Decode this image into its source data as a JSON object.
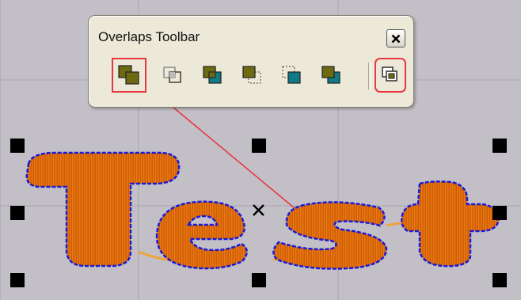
{
  "toolbar": {
    "title": "Overlaps Toolbar",
    "buttons": [
      {
        "icon": "overlap-all-icon",
        "tooltip_state": "highlighted"
      },
      {
        "icon": "overlap-outline-icon"
      },
      {
        "icon": "overlap-front-icon"
      },
      {
        "icon": "overlap-back-dotted-icon"
      },
      {
        "icon": "overlap-front-dotted-icon"
      },
      {
        "icon": "overlap-swap-icon"
      },
      {
        "icon": "overlap-settings-icon",
        "tooltip_state": "highlighted"
      }
    ]
  },
  "canvas": {
    "artwork_text": "Test",
    "selection_handles": 8
  },
  "colors": {
    "canvas_bg": "#c3bfc6",
    "grid_line": "#a9a5ad",
    "olive": "#6e6a12",
    "teal": "#117a86",
    "highlight_red": "#e8373e",
    "stitch_orange": "#e8700a",
    "stitch_outline": "#1a1ad8"
  }
}
